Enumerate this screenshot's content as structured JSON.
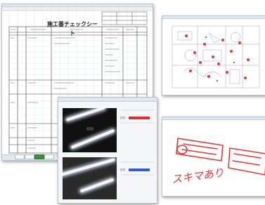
{
  "checksheet": {
    "title": "施工番チェックシート",
    "tabs": [
      "",
      "",
      "",
      ""
    ]
  },
  "photo_dialog": {
    "fields": [
      {
        "label": "日付",
        "color": "#e02f2f"
      },
      {
        "label": "日付",
        "color": "#2f5fd8"
      }
    ]
  },
  "annotation": {
    "handwriting": "スキマあり",
    "ink_color": "#e23a3a"
  },
  "colors": {
    "window_border": "#b9c2cc",
    "ink_red": "#e23a3a",
    "active_tab": "#3f8f3f"
  }
}
